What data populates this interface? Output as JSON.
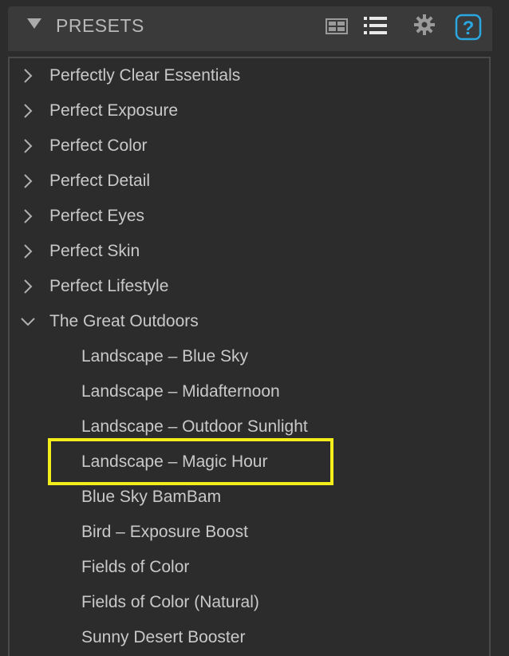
{
  "panel": {
    "title": "PRESETS",
    "icons": [
      "collapse-triangle-icon",
      "grid-view-icon",
      "list-view-icon",
      "gear-icon",
      "help-icon"
    ],
    "help_glyph": "?"
  },
  "tree": {
    "folders": [
      {
        "label": "Perfectly Clear Essentials",
        "expanded": false
      },
      {
        "label": "Perfect Exposure",
        "expanded": false
      },
      {
        "label": "Perfect Color",
        "expanded": false
      },
      {
        "label": "Perfect Detail",
        "expanded": false
      },
      {
        "label": "Perfect Eyes",
        "expanded": false
      },
      {
        "label": "Perfect Skin",
        "expanded": false
      },
      {
        "label": "Perfect Lifestyle",
        "expanded": false
      },
      {
        "label": "The Great Outdoors",
        "expanded": true
      }
    ],
    "children": [
      {
        "label": "Landscape – Blue Sky"
      },
      {
        "label": "Landscape – Midafternoon"
      },
      {
        "label": "Landscape – Outdoor Sunlight"
      },
      {
        "label": "Landscape – Magic Hour",
        "highlighted": true
      },
      {
        "label": "Blue Sky BamBam"
      },
      {
        "label": "Bird – Exposure Boost"
      },
      {
        "label": "Fields of Color"
      },
      {
        "label": "Fields of Color (Natural)"
      },
      {
        "label": "Sunny Desert Booster"
      }
    ]
  },
  "colors": {
    "background": "#2c2c2c",
    "header": "#3a3a3a",
    "text": "#c9c9c9",
    "highlight": "#f3ee1b",
    "help_accent": "#2aa7e0"
  }
}
